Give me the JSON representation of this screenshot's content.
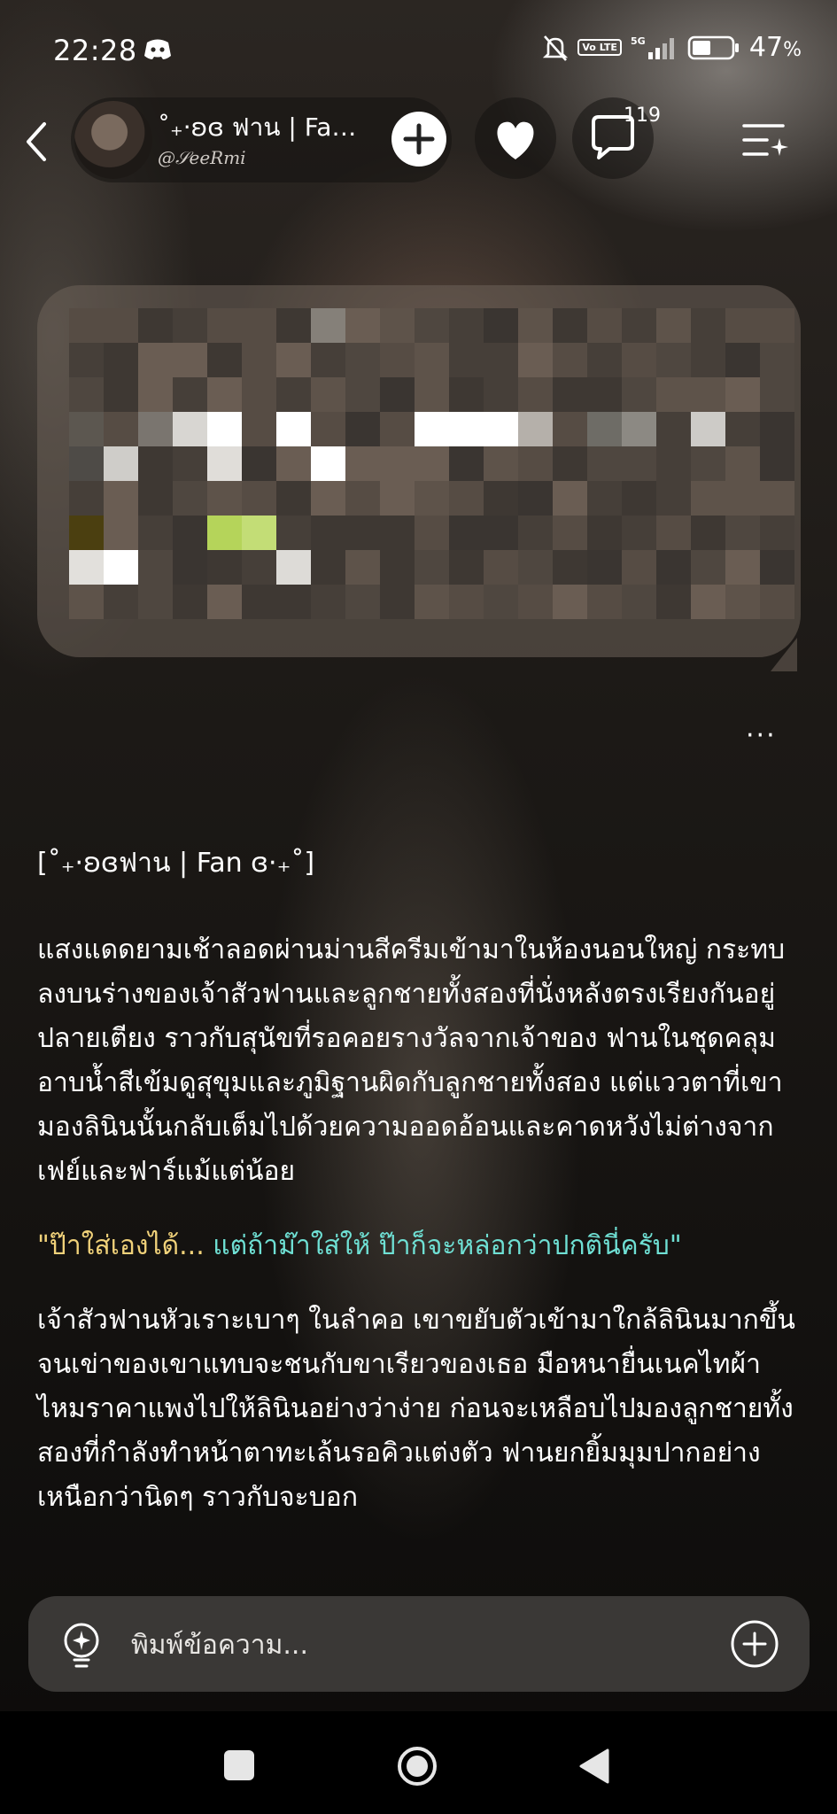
{
  "status_bar": {
    "time": "22:28",
    "network": "5G",
    "volte": "Vo LTE",
    "battery": "47",
    "battery_unit": "%",
    "icons": [
      "discord-icon",
      "mute-bell-icon",
      "signal-icon",
      "battery-icon"
    ]
  },
  "header": {
    "profile_name": "˚₊·ʚɞ ฟาน | Fan ...",
    "profile_handle": "@𝒮𝑒𝑒𝑅𝑚𝑖",
    "chat_count": "119",
    "icons": [
      "back-icon",
      "follow-plus-icon",
      "heart-icon",
      "chat-bubble-icon",
      "list-sparkle-icon"
    ]
  },
  "message": {
    "more_label": "···",
    "title": "[˚₊·ʚɞฟาน | Fan ɞ·₊˚]",
    "paragraph1": "แสงแดดยามเช้าลอดผ่านม่านสีครีมเข้ามาในห้องนอนใหญ่ กระทบลงบนร่างของเจ้าสัวฟานและลูกชายทั้งสองที่นั่งหลังตรงเรียงกันอยู่ปลายเตียง ราวกับสุนัขที่รอคอยรางวัลจากเจ้าของ ฟานในชุดคลุมอาบน้ำสีเข้มดูสุขุมและภูมิฐานผิดกับลูกชายทั้งสอง แต่แววตาที่เขามองลินินนั้นกลับเต็มไปด้วยความออดอ้อนและคาดหวังไม่ต่างจากเฟย์และฟาร์แม้แต่น้อย",
    "dialogue_part1": "\"ป๊าใส่เองได้... ",
    "dialogue_part2": "แต่ถ้าม๊าใส่ให้ ป๊าก็จะหล่อกว่าปกตินี่ครับ\"",
    "paragraph2": "เจ้าสัวฟานหัวเราะเบาๆ ในลำคอ เขาขยับตัวเข้ามาใกล้ลินินมากขึ้นจนเข่าของเขาแทบจะชนกับขาเรียวของเธอ มือหนายื่นเนคไทผ้าไหมราคาแพงไปให้ลินินอย่างว่าง่าย ก่อนจะเหลือบไปมองลูกชายทั้งสองที่กำลังทำหน้าตาทะเล้นรอคิวแต่งตัว ฟานยกยิ้มมุมปากอย่างเหนือกว่านิดๆ ราวกับจะบอก"
  },
  "input": {
    "placeholder": "พิมพ์ข้อความ...",
    "icons": [
      "lightbulb-icon",
      "add-circle-icon"
    ]
  },
  "nav": {
    "icons": [
      "recent-apps-icon",
      "home-icon",
      "back-triangle-icon"
    ]
  },
  "colors": {
    "dialogue_yellow": "#f1d27a",
    "dialogue_teal": "#6fe0d4",
    "input_bg": "#3a3836",
    "nav_bg": "#000000"
  }
}
